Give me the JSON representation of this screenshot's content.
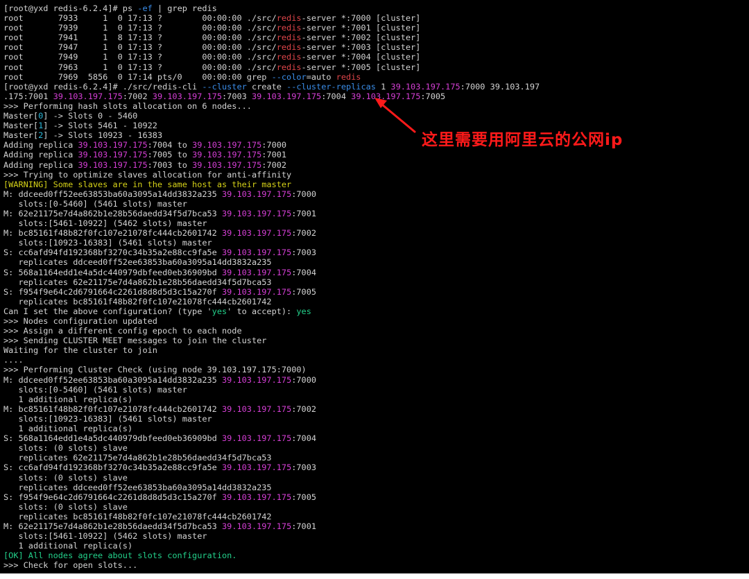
{
  "terminal": {
    "colors": {
      "background": "#000000",
      "text": "#d4d4d4",
      "red": "#e0454a",
      "blue": "#3b8eea",
      "magenta": "#d63fd6",
      "yellow": "#d6d218",
      "green": "#23d18b",
      "cyan": "#29b8db"
    },
    "lines": [
      [
        {
          "t": "[root@yxd redis-6.2.4]# ps "
        },
        {
          "t": "-ef",
          "c": "blue"
        },
        {
          "t": " | grep redis"
        }
      ],
      [
        {
          "t": "root       7933     1  0 17:13 ?        00:00:00 ./src/"
        },
        {
          "t": "redis",
          "c": "red"
        },
        {
          "t": "-server *:7000 [cluster]"
        }
      ],
      [
        {
          "t": "root       7939     1  0 17:13 ?        00:00:00 ./src/"
        },
        {
          "t": "redis",
          "c": "red"
        },
        {
          "t": "-server *:7001 [cluster]"
        }
      ],
      [
        {
          "t": "root       7941     1  8 17:13 ?        00:00:00 ./src/"
        },
        {
          "t": "redis",
          "c": "red"
        },
        {
          "t": "-server *:7002 [cluster]"
        }
      ],
      [
        {
          "t": "root       7947     1  0 17:13 ?        00:00:00 ./src/"
        },
        {
          "t": "redis",
          "c": "red"
        },
        {
          "t": "-server *:7003 [cluster]"
        }
      ],
      [
        {
          "t": "root       7949     1  0 17:13 ?        00:00:00 ./src/"
        },
        {
          "t": "redis",
          "c": "red"
        },
        {
          "t": "-server *:7004 [cluster]"
        }
      ],
      [
        {
          "t": "root       7963     1  0 17:13 ?        00:00:00 ./src/"
        },
        {
          "t": "redis",
          "c": "red"
        },
        {
          "t": "-server *:7005 [cluster]"
        }
      ],
      [
        {
          "t": "root       7969  5856  0 17:14 pts/0    00:00:00 grep "
        },
        {
          "t": "--color",
          "c": "blue"
        },
        {
          "t": "=auto "
        },
        {
          "t": "redis",
          "c": "red"
        }
      ],
      [
        {
          "t": "[root@yxd redis-6.2.4]# ./src/redis-cli "
        },
        {
          "t": "--cluster",
          "c": "blue"
        },
        {
          "t": " create "
        },
        {
          "t": "--cluster-replicas",
          "c": "blue"
        },
        {
          "t": " 1 "
        },
        {
          "t": "39.103.197.175",
          "c": "mag"
        },
        {
          "t": ":7000 39.103.197"
        }
      ],
      [
        {
          "t": ".175:7001 "
        },
        {
          "t": "39.103.197.175",
          "c": "mag"
        },
        {
          "t": ":7002 "
        },
        {
          "t": "39.103.197.175",
          "c": "mag"
        },
        {
          "t": ":7003 "
        },
        {
          "t": "39.103.197.175",
          "c": "mag"
        },
        {
          "t": ":7004 "
        },
        {
          "t": "39.103.197.175",
          "c": "mag"
        },
        {
          "t": ":7005"
        }
      ],
      [
        {
          "t": ">>> Performing hash slots allocation on 6 nodes..."
        }
      ],
      [
        {
          "t": "Master["
        },
        {
          "t": "0",
          "c": "cyan"
        },
        {
          "t": "] -> Slots 0 - 5460"
        }
      ],
      [
        {
          "t": "Master["
        },
        {
          "t": "1",
          "c": "cyan"
        },
        {
          "t": "] -> Slots 5461 - 10922"
        }
      ],
      [
        {
          "t": "Master["
        },
        {
          "t": "2",
          "c": "cyan"
        },
        {
          "t": "] -> Slots 10923 - 16383"
        }
      ],
      [
        {
          "t": "Adding replica "
        },
        {
          "t": "39.103.197.175",
          "c": "mag"
        },
        {
          "t": ":7004 to "
        },
        {
          "t": "39.103.197.175",
          "c": "mag"
        },
        {
          "t": ":7000"
        }
      ],
      [
        {
          "t": "Adding replica "
        },
        {
          "t": "39.103.197.175",
          "c": "mag"
        },
        {
          "t": ":7005 to "
        },
        {
          "t": "39.103.197.175",
          "c": "mag"
        },
        {
          "t": ":7001"
        }
      ],
      [
        {
          "t": "Adding replica "
        },
        {
          "t": "39.103.197.175",
          "c": "mag"
        },
        {
          "t": ":7003 to "
        },
        {
          "t": "39.103.197.175",
          "c": "mag"
        },
        {
          "t": ":7002"
        }
      ],
      [
        {
          "t": ">>> Trying to optimize slaves allocation for anti-affinity"
        }
      ],
      [
        {
          "t": "[WARNING] Some slaves are in the same host as their master",
          "c": "yel"
        }
      ],
      [
        {
          "t": "M: ddceed0ff52ee63853ba60a3095a14dd3832a235 "
        },
        {
          "t": "39.103.197.175",
          "c": "mag"
        },
        {
          "t": ":7000"
        }
      ],
      [
        {
          "t": "   slots:[0-5460] (5461 slots) master"
        }
      ],
      [
        {
          "t": "M: 62e21175e7d4a862b1e28b56daedd34f5d7bca53 "
        },
        {
          "t": "39.103.197.175",
          "c": "mag"
        },
        {
          "t": ":7001"
        }
      ],
      [
        {
          "t": "   slots:[5461-10922] (5462 slots) master"
        }
      ],
      [
        {
          "t": "M: bc85161f48b82f0fc107e21078fc444cb2601742 "
        },
        {
          "t": "39.103.197.175",
          "c": "mag"
        },
        {
          "t": ":7002"
        }
      ],
      [
        {
          "t": "   slots:[10923-16383] (5461 slots) master"
        }
      ],
      [
        {
          "t": "S: cc6afd94fd192368bf3270c34b35a2e88cc9fa5e "
        },
        {
          "t": "39.103.197.175",
          "c": "mag"
        },
        {
          "t": ":7003"
        }
      ],
      [
        {
          "t": "   replicates ddceed0ff52ee63853ba60a3095a14dd3832a235"
        }
      ],
      [
        {
          "t": "S: 568a1164edd1e4a5dc440979dbfeed0eb36909bd "
        },
        {
          "t": "39.103.197.175",
          "c": "mag"
        },
        {
          "t": ":7004"
        }
      ],
      [
        {
          "t": "   replicates 62e21175e7d4a862b1e28b56daedd34f5d7bca53"
        }
      ],
      [
        {
          "t": "S: f954f9e64c2d6791664c2261d8d8d5d3c15a270f "
        },
        {
          "t": "39.103.197.175",
          "c": "mag"
        },
        {
          "t": ":7005"
        }
      ],
      [
        {
          "t": "   replicates bc85161f48b82f0fc107e21078fc444cb2601742"
        }
      ],
      [
        {
          "t": "Can I set the above configuration? (type '"
        },
        {
          "t": "yes",
          "c": "grn"
        },
        {
          "t": "' to accept): "
        },
        {
          "t": "yes",
          "c": "grn"
        }
      ],
      [
        {
          "t": ">>> Nodes configuration updated"
        }
      ],
      [
        {
          "t": ">>> Assign a different config epoch to each node"
        }
      ],
      [
        {
          "t": ">>> Sending CLUSTER MEET messages to join the cluster"
        }
      ],
      [
        {
          "t": "Waiting for the cluster to join"
        }
      ],
      [
        {
          "t": "...."
        }
      ],
      [
        {
          "t": ">>> Performing Cluster Check (using node 39.103.197.175:7000)"
        }
      ],
      [
        {
          "t": "M: ddceed0ff52ee63853ba60a3095a14dd3832a235 "
        },
        {
          "t": "39.103.197.175",
          "c": "mag"
        },
        {
          "t": ":7000"
        }
      ],
      [
        {
          "t": "   slots:[0-5460] (5461 slots) master"
        }
      ],
      [
        {
          "t": "   1 additional replica(s)"
        }
      ],
      [
        {
          "t": "M: bc85161f48b82f0fc107e21078fc444cb2601742 "
        },
        {
          "t": "39.103.197.175",
          "c": "mag"
        },
        {
          "t": ":7002"
        }
      ],
      [
        {
          "t": "   slots:[10923-16383] (5461 slots) master"
        }
      ],
      [
        {
          "t": "   1 additional replica(s)"
        }
      ],
      [
        {
          "t": "S: 568a1164edd1e4a5dc440979dbfeed0eb36909bd "
        },
        {
          "t": "39.103.197.175",
          "c": "mag"
        },
        {
          "t": ":7004"
        }
      ],
      [
        {
          "t": "   slots: (0 slots) slave"
        }
      ],
      [
        {
          "t": "   replicates 62e21175e7d4a862b1e28b56daedd34f5d7bca53"
        }
      ],
      [
        {
          "t": "S: cc6afd94fd192368bf3270c34b35a2e88cc9fa5e "
        },
        {
          "t": "39.103.197.175",
          "c": "mag"
        },
        {
          "t": ":7003"
        }
      ],
      [
        {
          "t": "   slots: (0 slots) slave"
        }
      ],
      [
        {
          "t": "   replicates ddceed0ff52ee63853ba60a3095a14dd3832a235"
        }
      ],
      [
        {
          "t": "S: f954f9e64c2d6791664c2261d8d8d5d3c15a270f "
        },
        {
          "t": "39.103.197.175",
          "c": "mag"
        },
        {
          "t": ":7005"
        }
      ],
      [
        {
          "t": "   slots: (0 slots) slave"
        }
      ],
      [
        {
          "t": "   replicates bc85161f48b82f0fc107e21078fc444cb2601742"
        }
      ],
      [
        {
          "t": "M: 62e21175e7d4a862b1e28b56daedd34f5d7bca53 "
        },
        {
          "t": "39.103.197.175",
          "c": "mag"
        },
        {
          "t": ":7001"
        }
      ],
      [
        {
          "t": "   slots:[5461-10922] (5462 slots) master"
        }
      ],
      [
        {
          "t": "   1 additional replica(s)"
        }
      ],
      [
        {
          "t": "[OK] All nodes agree about slots configuration.",
          "c": "grn"
        }
      ],
      [
        {
          "t": ">>> Check for open slots..."
        }
      ]
    ]
  },
  "annotation": {
    "text": "这里需要用阿里云的公网ip",
    "color": "#ff1a1a",
    "icon": "arrow-icon"
  }
}
